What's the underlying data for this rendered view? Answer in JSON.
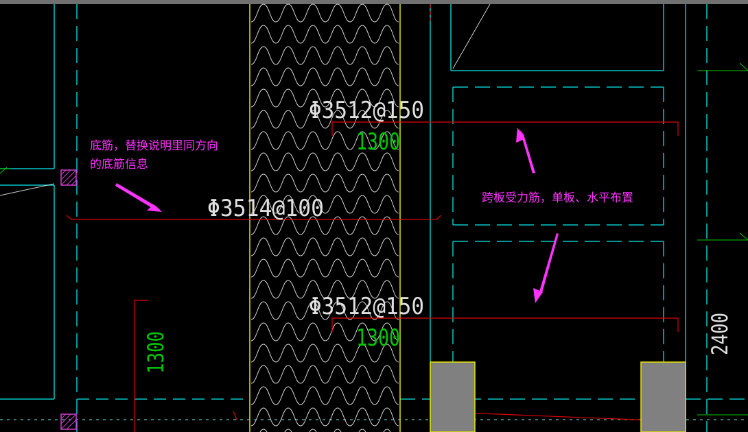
{
  "colors": {
    "background": "#000000",
    "wall_line": "#00c8c8",
    "axis_line": "#00c8c8",
    "insulation_edge": "#e6e600",
    "insulation_pattern": "#d8d8d8",
    "rebar_line": "#e00000",
    "dimension_text": "#00c800",
    "rebar_text": "#e0e0e0",
    "annotation": "#ff33ff",
    "column_fill": "#808080",
    "column_edge": "#e6e600",
    "green_marker": "#00c800",
    "top_bar": "#707070"
  },
  "rebar_labels": {
    "top": "Φ3512@150",
    "middle": "Φ3514@100",
    "bottom": "Φ3512@150"
  },
  "dimensions": {
    "top": "1300",
    "bottom": "1300",
    "left_vertical": "1300",
    "right_vertical": "2400"
  },
  "annotations": {
    "left_line1": "底筋，替换说明里同方向",
    "left_line2": "的底筋信息",
    "right": "跨板受力筋，单板、水平布置"
  },
  "icons": {
    "hatch_marker": "hatched-square-icon",
    "arrow": "magenta-arrow-icon"
  }
}
